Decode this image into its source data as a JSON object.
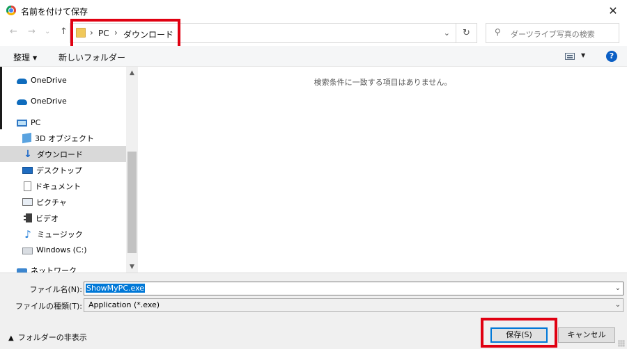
{
  "window": {
    "title": "名前を付けて保存"
  },
  "nav": {
    "back": "←",
    "forward": "→",
    "recent": "⌄",
    "up": "↑",
    "breadcrumb": [
      "PC",
      "ダウンロード"
    ],
    "search_placeholder": "ダーツライブ写真の検索"
  },
  "toolbar": {
    "organize_label": "整理",
    "new_folder_label": "新しいフォルダー"
  },
  "sidebar": {
    "items": [
      {
        "label": "OneDrive",
        "icon": "cloud-icon"
      },
      {
        "label": "OneDrive",
        "icon": "cloud-icon"
      },
      {
        "label": "PC",
        "icon": "pc-icon"
      },
      {
        "label": "3D オブジェクト",
        "icon": "3d-objects-icon"
      },
      {
        "label": "ダウンロード",
        "icon": "download-icon",
        "selected": true
      },
      {
        "label": "デスクトップ",
        "icon": "desktop-icon"
      },
      {
        "label": "ドキュメント",
        "icon": "document-icon"
      },
      {
        "label": "ピクチャ",
        "icon": "pictures-icon"
      },
      {
        "label": "ビデオ",
        "icon": "video-icon"
      },
      {
        "label": "ミュージック",
        "icon": "music-icon"
      },
      {
        "label": "Windows (C:)",
        "icon": "drive-icon"
      },
      {
        "label": "ネットワーク",
        "icon": "network-icon"
      }
    ]
  },
  "content": {
    "empty_message": "検索条件に一致する項目はありません。"
  },
  "form": {
    "filename_label": "ファイル名(N):",
    "filename_value": "ShowMyPC.exe",
    "filetype_label": "ファイルの種類(T):",
    "filetype_value": "Application (*.exe)"
  },
  "footer": {
    "hide_folders_label": "フォルダーの非表示",
    "save_label": "保存(S)",
    "cancel_label": "キャンセル"
  },
  "colors": {
    "accent": "#0078d7",
    "highlight": "#e00011",
    "selected_row": "#d9d9d9"
  }
}
